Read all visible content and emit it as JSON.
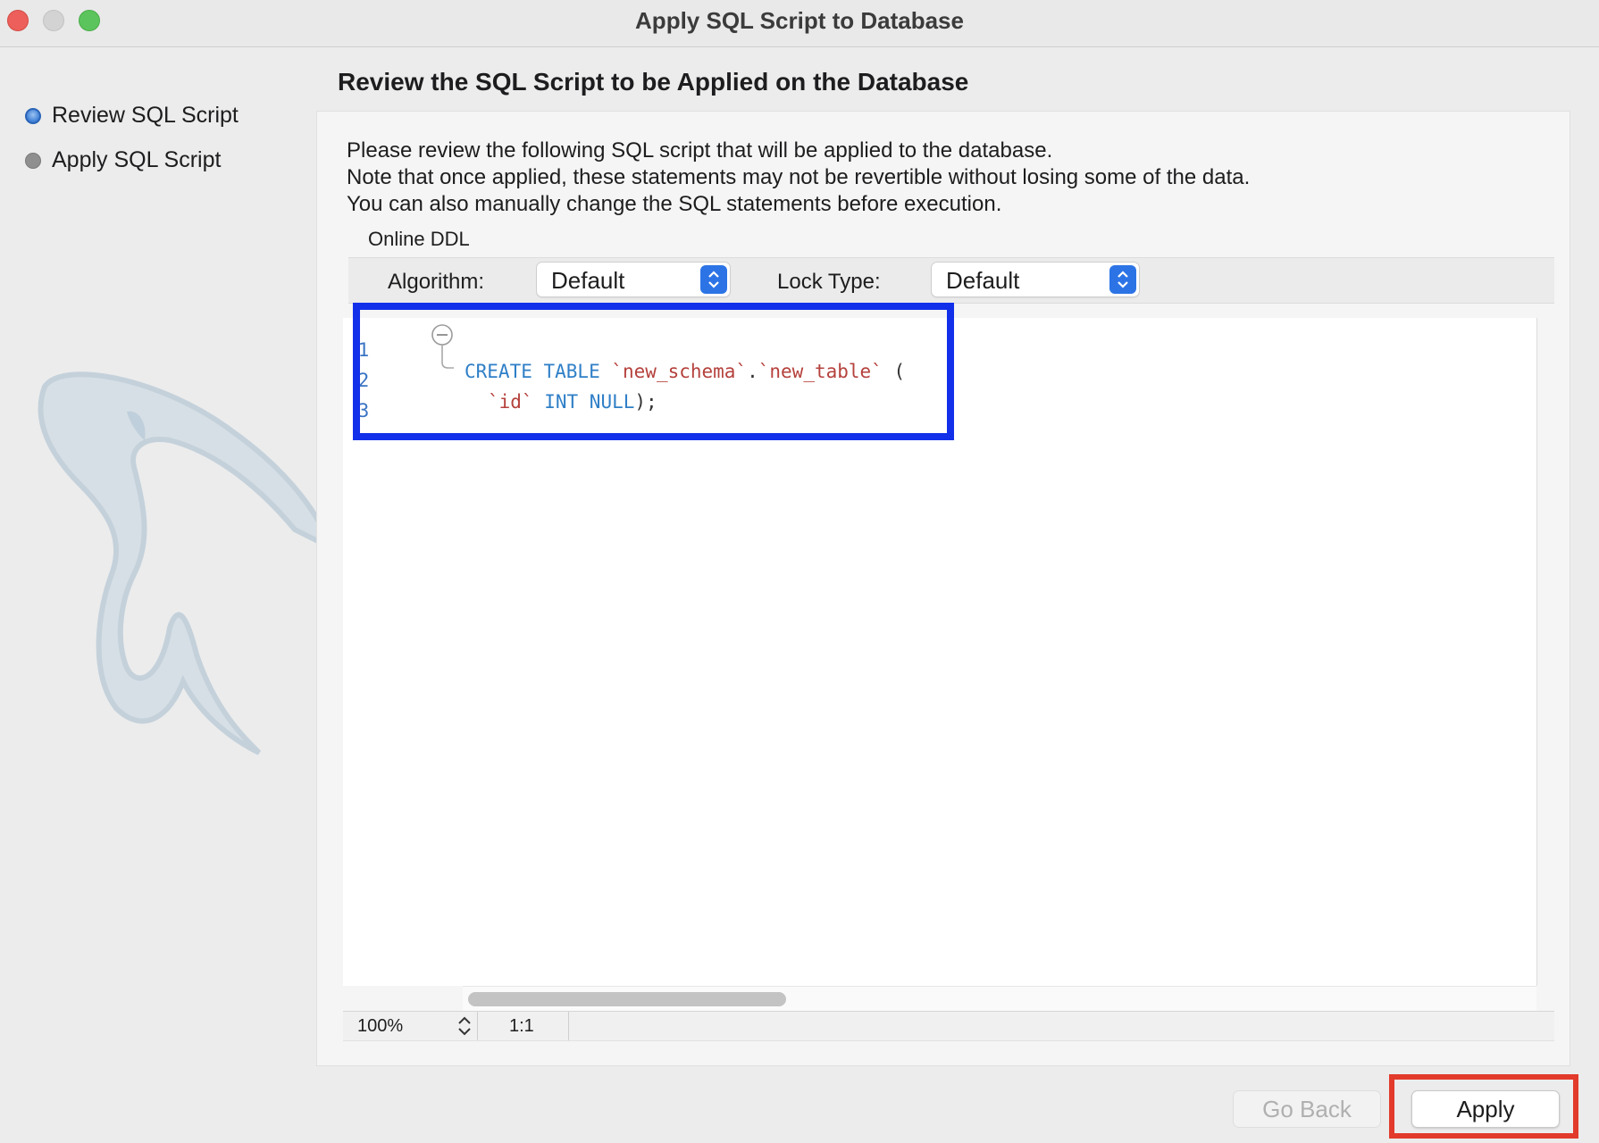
{
  "window": {
    "title": "Apply SQL Script to Database"
  },
  "sidebar": {
    "steps": [
      {
        "label": "Review SQL Script",
        "state": "active"
      },
      {
        "label": "Apply SQL Script",
        "state": "inactive"
      }
    ]
  },
  "main": {
    "heading": "Review the SQL Script to be Applied on the Database",
    "description": [
      "Please review the following SQL script that will be applied to the database.",
      "Note that once applied, these statements may not be revertible without losing some of the data.",
      "You can also manually change the SQL statements before execution."
    ],
    "online_ddl": {
      "section_label": "Online DDL",
      "algorithm_label": "Algorithm:",
      "algorithm_value": "Default",
      "lock_type_label": "Lock Type:",
      "lock_type_value": "Default"
    },
    "editor": {
      "line_numbers": [
        "1",
        "2",
        "3"
      ],
      "lines": [
        {
          "kw1": "CREATE TABLE",
          "ident1": "`new_schema`",
          "dot": ".",
          "ident2": "`new_table`",
          "tail": " ("
        },
        {
          "ident": "`id`",
          "kw": "INT NULL",
          "tail": ");"
        },
        {}
      ],
      "status": {
        "zoom": "100%",
        "cursor": "1:1"
      }
    }
  },
  "footer": {
    "go_back_label": "Go Back",
    "apply_label": "Apply"
  },
  "colors": {
    "keyword": "#2f7fc7",
    "identifier": "#b5413c",
    "line_number": "#3a74c4",
    "highlight_editor": "#1230ea",
    "highlight_apply": "#e23a2b",
    "accent": "#2c74e6"
  }
}
